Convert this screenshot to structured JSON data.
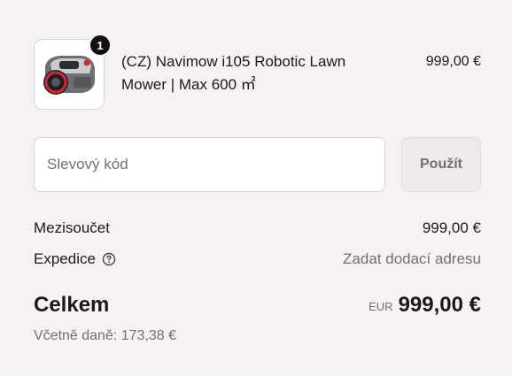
{
  "line_item": {
    "title": "(CZ) Navimow i105 Robotic Lawn Mower | Max 600 ㎡",
    "price": "999,00 €",
    "quantity": "1",
    "image_icon": "robotic-mower-image"
  },
  "discount": {
    "placeholder": "Slevový kód",
    "value": "",
    "apply_label": "Použít"
  },
  "summary": {
    "subtotal_label": "Mezisoučet",
    "subtotal_value": "999,00 €",
    "shipping_label": "Expedice",
    "shipping_help_icon": "question-circle-icon",
    "shipping_value": "Zadat dodací adresu",
    "total_label": "Celkem",
    "currency_code": "EUR",
    "total_value": "999,00 €",
    "tax_note": "Včetně daně: 173,38 €"
  },
  "colors": {
    "background": "#f5f2f1",
    "text": "#1a1a1a",
    "muted_text": "#707070",
    "badge": "#111111",
    "mower_accent": "#d9262c"
  }
}
